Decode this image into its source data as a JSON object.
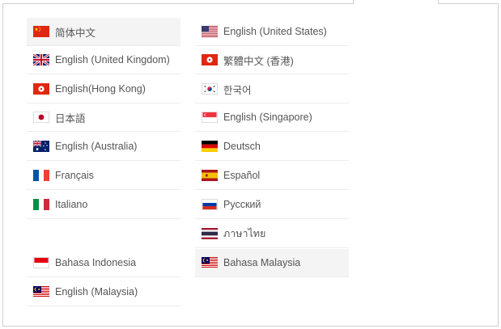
{
  "languages": {
    "left": [
      {
        "label": "简体中文",
        "flag": "china-flag-icon",
        "highlight": true
      },
      {
        "label": "English (United Kingdom)",
        "flag": "uk-flag-icon"
      },
      {
        "label": "English(Hong Kong)",
        "flag": "hong-kong-flag-icon"
      },
      {
        "label": "日本語",
        "flag": "japan-flag-icon"
      },
      {
        "label": "English (Australia)",
        "flag": "australia-flag-icon"
      },
      {
        "label": "Français",
        "flag": "france-flag-icon"
      },
      {
        "label": "Italiano",
        "flag": "italy-flag-icon"
      },
      {
        "label": "Bahasa Indonesia",
        "flag": "indonesia-flag-icon"
      },
      {
        "label": "English (Malaysia)",
        "flag": "malaysia-flag-icon"
      }
    ],
    "right": [
      {
        "label": "English (United States)",
        "flag": "usa-flag-icon"
      },
      {
        "label": "繁體中文 (香港)",
        "flag": "hong-kong-flag-icon"
      },
      {
        "label": "한국어",
        "flag": "south-korea-flag-icon"
      },
      {
        "label": "English (Singapore)",
        "flag": "singapore-flag-icon"
      },
      {
        "label": "Deutsch",
        "flag": "germany-flag-icon"
      },
      {
        "label": "Español",
        "flag": "spain-flag-icon"
      },
      {
        "label": "Русский",
        "flag": "russia-flag-icon"
      },
      {
        "label": "ภาษาไทย",
        "flag": "thailand-flag-icon"
      },
      {
        "label": "Bahasa Malaysia",
        "flag": "malaysia-flag-icon",
        "highlight": true
      }
    ]
  },
  "colors": {
    "border": "#cfcfcf",
    "highlight_bg": "#f4f4f4",
    "text": "#555555"
  }
}
